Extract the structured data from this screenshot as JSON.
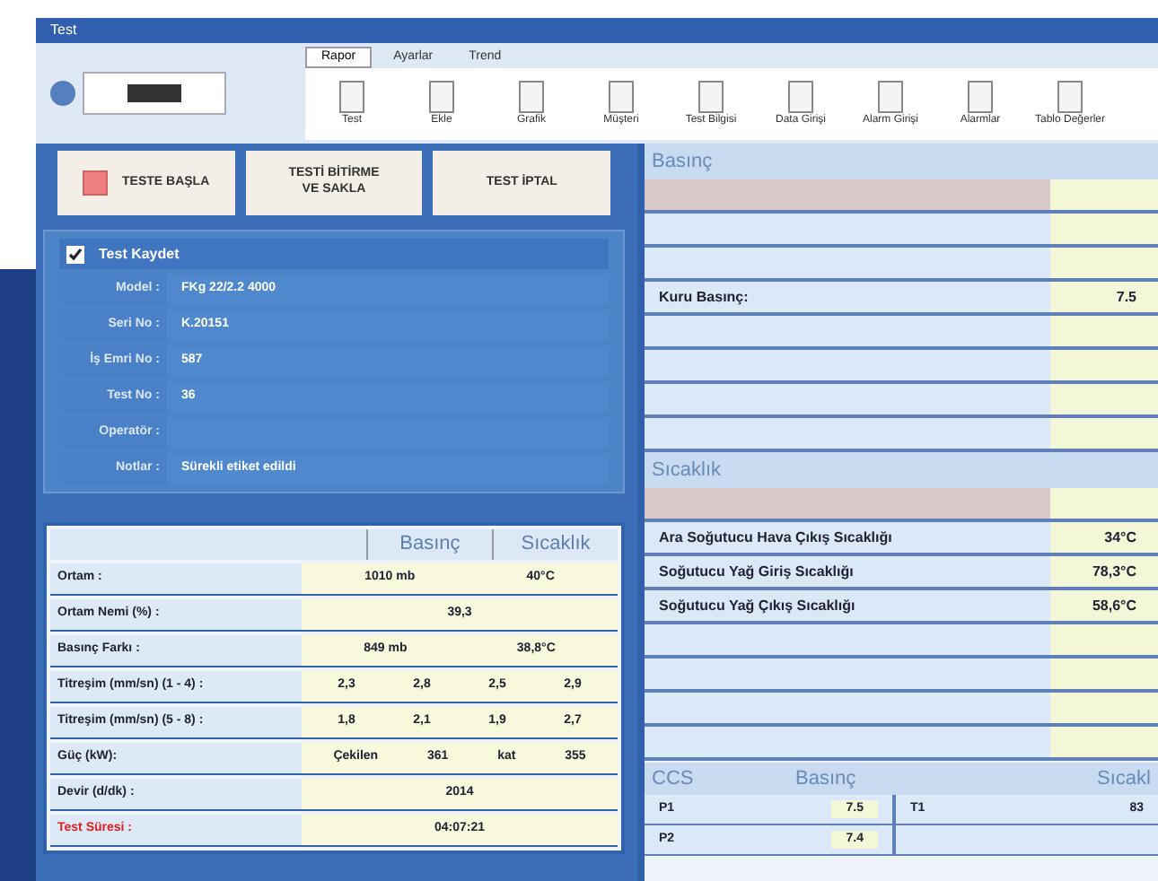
{
  "window": {
    "title": "Test"
  },
  "ribbon": {
    "tabs": [
      {
        "label": "Rapor",
        "selected": true
      },
      {
        "label": "Ayarlar",
        "selected": false
      },
      {
        "label": "Trend",
        "selected": false
      }
    ],
    "buttons": [
      "Test",
      "Ekle",
      "Grafik",
      "Müşteri",
      "Test Bilgisi",
      "Data Girişi",
      "Alarm Girişi",
      "Alarmlar",
      "Tablo Değerler"
    ]
  },
  "actions": [
    {
      "label": "TESTE BAŞLA",
      "kind": "start"
    },
    {
      "label": "TESTİ BİTİRME\nVE SAKLA",
      "kind": "plain"
    },
    {
      "label": "TEST İPTAL",
      "kind": "plain"
    }
  ],
  "record": {
    "label": "Test Kaydet",
    "checked": true,
    "fields": [
      {
        "label": "Model :",
        "value": "FKg 22/2.2 4000"
      },
      {
        "label": "Seri No :",
        "value": "K.20151"
      },
      {
        "label": "İş Emri No :",
        "value": "587"
      },
      {
        "label": "Test No :",
        "value": "36"
      },
      {
        "label": "Operatör :"
      },
      {
        "label": "Notlar :",
        "value": "Sürekli etiket edildi"
      }
    ]
  },
  "readings": {
    "columns": [
      "Basınç",
      "Sıcaklık"
    ],
    "rows": [
      {
        "label": "Ortam :",
        "cells": [
          "1010 mb",
          "40°C"
        ],
        "alert": false
      },
      {
        "label": "Ortam Nemi (%) :",
        "cells": [
          "39,3"
        ],
        "alert": false
      },
      {
        "label": "Basınç Farkı :",
        "cells": [
          "849 mb",
          "38,8°C"
        ],
        "alert": false
      },
      {
        "label": "Titreşim (mm/sn) (1 - 4) :",
        "cells": [
          "2,3",
          "2,8",
          "2,5",
          "2,9"
        ],
        "alert": false
      },
      {
        "label": "Titreşim (mm/sn) (5 - 8) :",
        "cells": [
          "1,8",
          "2,1",
          "1,9",
          "2,7"
        ],
        "alert": false
      },
      {
        "label": "Güç (kW):",
        "cells": [
          "Çekilen",
          "361",
          "kat",
          "355"
        ],
        "alert": false
      },
      {
        "label": "Devir (d/dk) :",
        "cells": [
          "2014"
        ],
        "alert": false
      },
      {
        "label": "Test Süresi :",
        "cells": [
          "04:07:21"
        ],
        "alert": true
      }
    ]
  },
  "pressure": {
    "title": "Basınç",
    "rows": [
      {},
      {},
      {},
      {
        "label": "Kuru Basınç:",
        "value": "7.5"
      },
      {},
      {},
      {},
      {}
    ]
  },
  "temperature": {
    "title": "Sıcaklık",
    "rows": [
      {},
      {
        "label": "Ara Soğutucu Hava Çıkış Sıcaklığı",
        "value": "34°C"
      },
      {
        "label": "Soğutucu Yağ Giriş Sıcaklığı",
        "value": "78,3°C"
      },
      {
        "label": "Soğutucu Yağ Çıkış Sıcaklığı",
        "value": "58,6°C"
      },
      {},
      {},
      {},
      {}
    ]
  },
  "ccs": {
    "title": "CCS",
    "columns": [
      "Basınç",
      "Sıcakl"
    ],
    "rows": [
      {
        "p_label": "P1",
        "p_value": "7.5",
        "t_label": "T1",
        "t_value": "83"
      },
      {
        "p_label": "P2",
        "p_value": "7.4"
      }
    ]
  }
}
